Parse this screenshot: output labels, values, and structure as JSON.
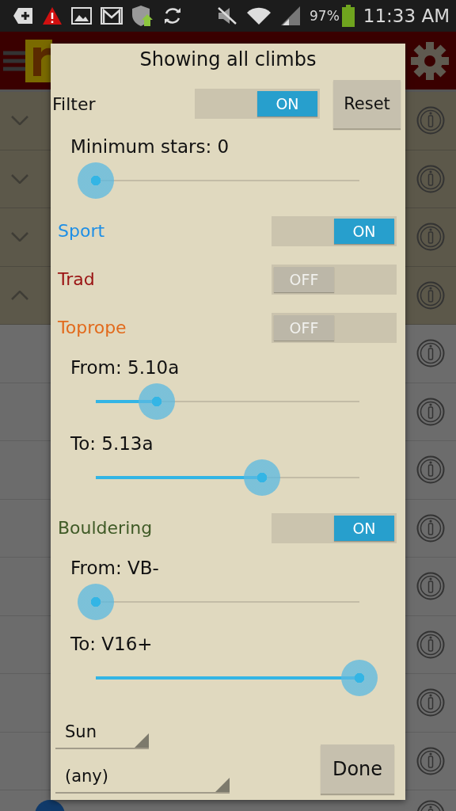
{
  "status_bar": {
    "battery": "97%",
    "time": "11:33 AM"
  },
  "list": {
    "groups": [
      {
        "expanded": false
      },
      {
        "expanded": false
      },
      {
        "expanded": false
      },
      {
        "expanded": true,
        "children": [
          {
            "kind": "covered"
          },
          {
            "kind": "covered"
          },
          {
            "kind": "covered"
          },
          {
            "kind": "covered"
          },
          {
            "kind": "covered"
          },
          {
            "kind": "covered"
          },
          {
            "kind": "covered"
          },
          {
            "kind": "covered"
          },
          {
            "kind": "climb"
          }
        ]
      }
    ]
  },
  "dialog": {
    "title": "Showing all climbs",
    "filter": {
      "label": "Filter",
      "on": true,
      "text": "ON"
    },
    "reset_button": "Reset",
    "items": [
      {
        "kind": "slider",
        "label": "Minimum stars: 0",
        "level": 0
      },
      {
        "kind": "toggle",
        "label": "Sport",
        "color": "#1e8fe6",
        "on": true,
        "text": "ON"
      },
      {
        "kind": "toggle",
        "label": "Trad",
        "color": "#9a1313",
        "on": false,
        "text": "OFF"
      },
      {
        "kind": "toggle",
        "label": "Toprope",
        "color": "#e26a1c",
        "on": false,
        "text": "OFF"
      },
      {
        "kind": "slider",
        "label": "From: 5.10a",
        "level": 0.23
      },
      {
        "kind": "slider",
        "label": "To: 5.13a",
        "level": 0.63
      },
      {
        "kind": "toggle",
        "label": "Bouldering",
        "color": "#3f5a26",
        "on": true,
        "text": "ON"
      },
      {
        "kind": "slider",
        "label": "From: VB-",
        "level": 0
      },
      {
        "kind": "slider",
        "label": "To: V16+",
        "level": 1
      }
    ],
    "dropdowns": [
      "Sun",
      "(any)"
    ],
    "done_button": "Done"
  }
}
